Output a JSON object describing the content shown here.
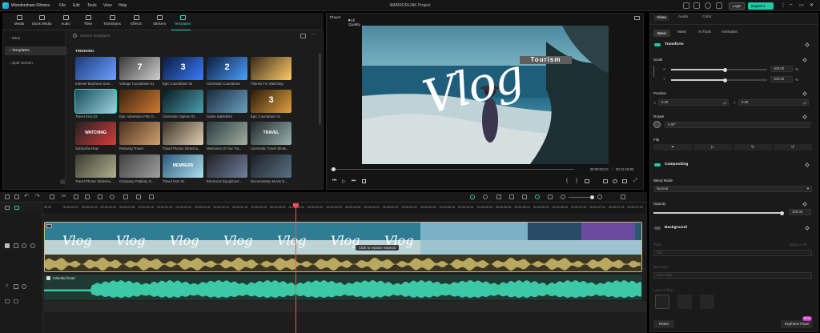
{
  "titlebar": {
    "app_name": "Wondershare Filmora",
    "menu": [
      "File",
      "Edit",
      "Tools",
      "View",
      "Help"
    ],
    "project_title": "4MIRRORLINK Project",
    "login_label": "Login",
    "export_label": "Export"
  },
  "media_tabs": [
    {
      "label": "Media",
      "icon": "media-icon"
    },
    {
      "label": "Stock Media",
      "icon": "stock-media-icon"
    },
    {
      "label": "Audio",
      "icon": "audio-icon"
    },
    {
      "label": "Titles",
      "icon": "titles-icon"
    },
    {
      "label": "Transitions",
      "icon": "transitions-icon"
    },
    {
      "label": "Effects",
      "icon": "effects-icon"
    },
    {
      "label": "Stickers",
      "icon": "stickers-icon"
    },
    {
      "label": "Templates",
      "icon": "templates-icon",
      "active": true
    }
  ],
  "sidebar": {
    "items": [
      {
        "label": "Mine"
      },
      {
        "label": "Templates",
        "active": true
      },
      {
        "label": "Split Screen"
      }
    ]
  },
  "search": {
    "placeholder": "Search templates"
  },
  "library": {
    "section_title": "TRENDING",
    "templates": [
      "Internet Business Sum...",
      "Vintage Countdown 01",
      "Epic Countdown 02",
      "Cinematic Countdown",
      "Thanks For Watching",
      "Travel Intro 02",
      "Epic Adventure Film O...",
      "Cinematic Opener 01",
      "Game Battlefield",
      "Epic Countdown 01",
      "Subscribe Now",
      "Relaxing Travel",
      "Travel Photos Slidesho...",
      "Memories Of Our Tra...",
      "Cinematic Travel Show...",
      "Travel Photos Slidesho...",
      "Company Publicity G...",
      "Travel Intro 01",
      "Electronic Equipment ...",
      "Documentary Movie E..."
    ],
    "thumb_texts": [
      "",
      "7",
      "3",
      "2",
      "",
      "",
      "",
      "",
      "",
      "3",
      "WATCHING",
      "",
      "",
      "",
      "TRAVEL",
      "",
      "",
      "MEMBERS",
      "",
      ""
    ]
  },
  "player": {
    "label": "Player",
    "quality": "Full Quality",
    "current_time": "00:00:03:10",
    "total_time": "00:11:16:02",
    "video_title": "Tourism",
    "video_script": "Vlog"
  },
  "properties": {
    "tabs": [
      "Video",
      "Audio",
      "Color"
    ],
    "subtabs": [
      "Basic",
      "Mask",
      "AI Tools",
      "Animation"
    ],
    "transform_title": "Transform",
    "scale_label": "Scale",
    "scale_x": "100.00",
    "scale_y": "100.00",
    "scale_unit": "%",
    "position_label": "Position",
    "pos_x": "0.00",
    "pos_y": "0.00",
    "pos_unit": "px",
    "rotate_label": "Rotate",
    "rotate_value": "0.00°",
    "flip_label": "Flip",
    "compositing_title": "Compositing",
    "blend_mode_label": "Blend Mode",
    "blend_mode_value": "Normal",
    "opacity_label": "Opacity",
    "opacity_value": "100.00",
    "background_title": "Background",
    "type_label": "Type",
    "apply_all": "Apply to All",
    "type_value": "Blur",
    "blur_style_label": "Blur style",
    "blur_style_value": "Basic Blur",
    "level_label": "Level of blur",
    "reset_label": "Reset",
    "keyframe_label": "Keyframe Panel",
    "new_badge": "NEW",
    "scale_fraction": 0.56,
    "opacity_fraction": 1.0
  },
  "timeline": {
    "ruler": [
      "00:00",
      "00:00:00:15",
      "00:00:01:05",
      "00:00:01:15",
      "00:00:02:05",
      "00:00:02:15",
      "00:00:03:05",
      "00:00:03:15",
      "00:00:04:05",
      "00:00:04:15",
      "00:00:05:05",
      "00:00:05:15",
      "00:00:06:05",
      "00:00:06:15",
      "00:00:07:05",
      "00:00:07:15"
    ],
    "ruler_extra": [
      "00:00:00:10",
      "00:00:00:20",
      "00:00:01:10",
      "00:00:01:20",
      "00:00:02:10",
      "00:00:02:20",
      "00:00:03:10",
      "00:00:03:20",
      "00:00:04:10",
      "00:00:04:20",
      "00:00:05:10",
      "00:00:05:20",
      "00:00:06:10",
      "00:00:06:20",
      "00:00:07:10",
      "00:00:07:20"
    ],
    "audio_clip_name": "Inherited heart",
    "replace_tooltip": "Click to replace material"
  },
  "colors": {
    "accent": "#1ec9a3",
    "playhead": "#ff4d5a",
    "audio": "#3cc9a5"
  }
}
